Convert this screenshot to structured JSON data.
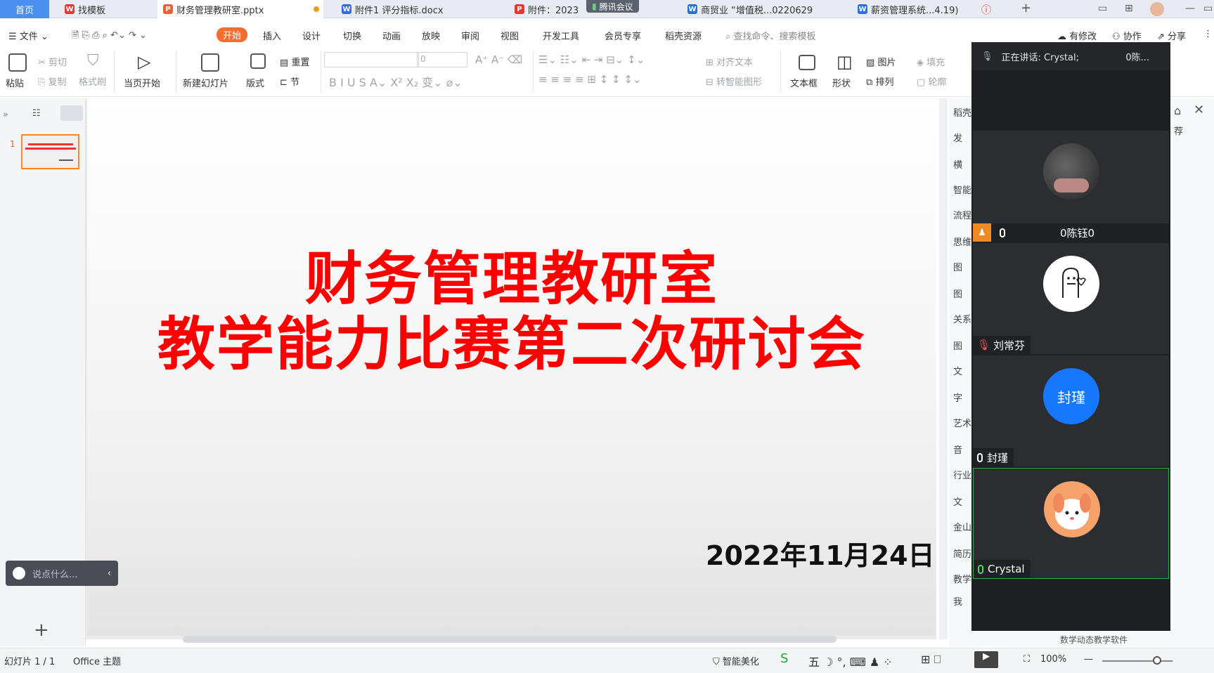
{
  "tabs": [
    {
      "label": "首页",
      "icon": "home",
      "color": "#4a8ef0"
    },
    {
      "label": "找模板",
      "icon": "wps-logo-icon",
      "color": "#e33"
    },
    {
      "label": "财务管理教研室.pptx",
      "icon": "ppt-file-icon",
      "color": "#e8623a"
    },
    {
      "label": "附件1 评分指标.docx",
      "icon": "word-file-icon",
      "color": "#2d6fd9"
    },
    {
      "label": "附件：2023",
      "icon": "pdf-file-icon",
      "color": "#e33"
    },
    {
      "label": "商贸业 “增值税...0220629",
      "icon": "word-file-icon",
      "color": "#2d6fd9"
    },
    {
      "label": "薪资管理系统...4.19)",
      "icon": "word-file-icon",
      "color": "#2d6fd9"
    }
  ],
  "meeting_badge": "腾讯会议",
  "menu": {
    "file": "文件",
    "items": [
      "开始",
      "插入",
      "设计",
      "切换",
      "动画",
      "放映",
      "审阅",
      "视图",
      "开发工具",
      "会员专享",
      "稻壳资源"
    ],
    "search_placeholder": "查找命令、搜索模板",
    "right": [
      "有修改",
      "协作",
      "分享"
    ]
  },
  "ribbon": {
    "paste": "粘贴",
    "cut": "剪切",
    "copy": "复制",
    "format_painter": "格式刷",
    "play_from_current": "当页开始",
    "new_slide": "新建幻灯片",
    "layout": "版式",
    "reset": "重置",
    "section": "节",
    "font_size": "0",
    "align_text": "对齐文本",
    "smartart": "转智能图形",
    "textbox": "文本框",
    "shape": "形状",
    "picture": "图片",
    "arrange": "排列",
    "fill": "填充",
    "outline": "轮廓"
  },
  "slide": {
    "number": "1",
    "title_line1": "财务管理教研室",
    "title_line2": "教学能力比赛第二次研讨会",
    "date": "2022年11月24日"
  },
  "chat_placeholder": "说点什么...",
  "right_pane": {
    "items": [
      "稻壳",
      "发",
      "横",
      "智能",
      "流程",
      "思维",
      "图",
      "图",
      "关系",
      "图",
      "文",
      "字",
      "艺术",
      "音",
      "行业",
      "文",
      "金山",
      "简历",
      "教学",
      "我"
    ],
    "bottom_label": "数学动态教学软件",
    "recommend": "荐"
  },
  "meeting": {
    "speaking_label": "正在讲话: Crystal;",
    "speaking_extra": "0陈...",
    "participants": [
      {
        "name": "0陈钰0",
        "avatar": "photo",
        "host": true
      },
      {
        "name": "刘常芬",
        "avatar": "drawing"
      },
      {
        "name": "封瑾",
        "avatar": "text",
        "avatar_text": "封瑾",
        "avatar_color": "#1677ff"
      },
      {
        "name": "Crystal",
        "avatar": "bunny",
        "active": true
      }
    ]
  },
  "status": {
    "slide_info": "幻灯片 1 / 1",
    "theme": "Office 主题",
    "beautify": "智能美化",
    "zoom": "100%"
  }
}
